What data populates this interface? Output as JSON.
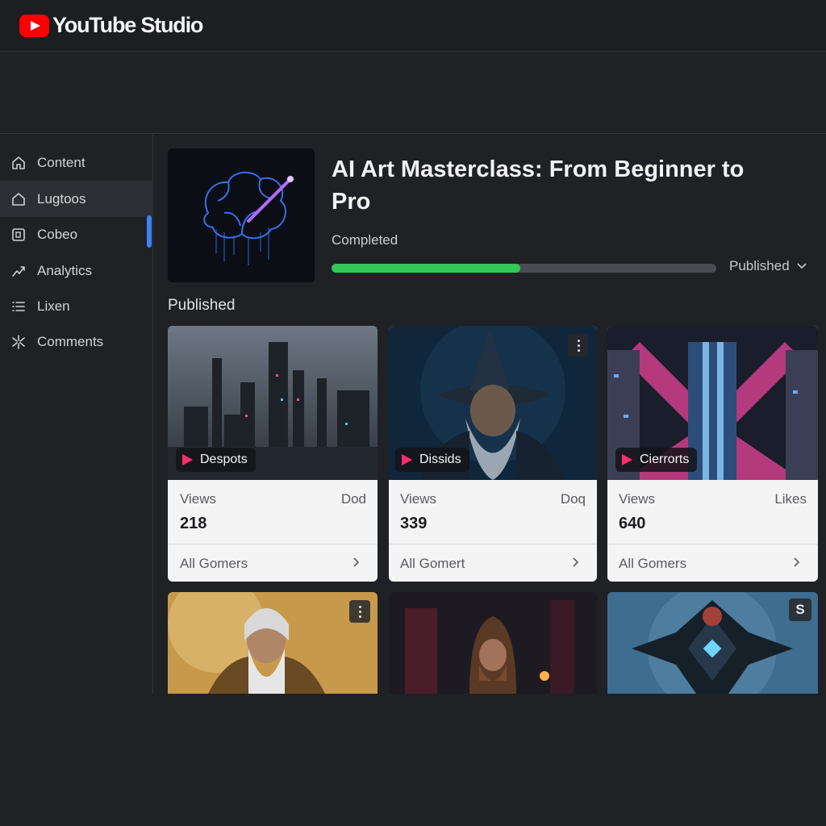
{
  "app": {
    "brand": "YouTube Studio"
  },
  "sidebar": {
    "items": [
      {
        "label": "Content",
        "icon": "home-icon"
      },
      {
        "label": "Lugtoos",
        "icon": "home-outline-icon"
      },
      {
        "label": "Cobeo",
        "icon": "square-icon"
      },
      {
        "label": "Analytics",
        "icon": "analytics-icon"
      },
      {
        "label": "Lixen",
        "icon": "list-icon"
      },
      {
        "label": "Comments",
        "icon": "sparkle-icon"
      }
    ]
  },
  "hero": {
    "title": "AI Art Masterclass: From Beginner to Pro",
    "status": "Completed",
    "progress": 0.49,
    "visibility": "Published"
  },
  "section": {
    "label": "Published"
  },
  "cards": [
    {
      "badge": "Despots",
      "stat_label": "Views",
      "stat_right": "Dod",
      "stat_value": "218",
      "link": "All Gomers"
    },
    {
      "badge": "Dissids",
      "stat_label": "Views",
      "stat_right": "Doq",
      "stat_value": "339",
      "link": "All Gomert"
    },
    {
      "badge": "Cierrorts",
      "stat_label": "Views",
      "stat_right": "Likes",
      "stat_value": "640",
      "link": "All Gomers"
    }
  ],
  "row2": {
    "third_badge": "S"
  },
  "colors": {
    "accent": "#3b82f6",
    "progress": "#34c759",
    "brand_red": "#ff0000",
    "play": "#ff2d6f"
  }
}
